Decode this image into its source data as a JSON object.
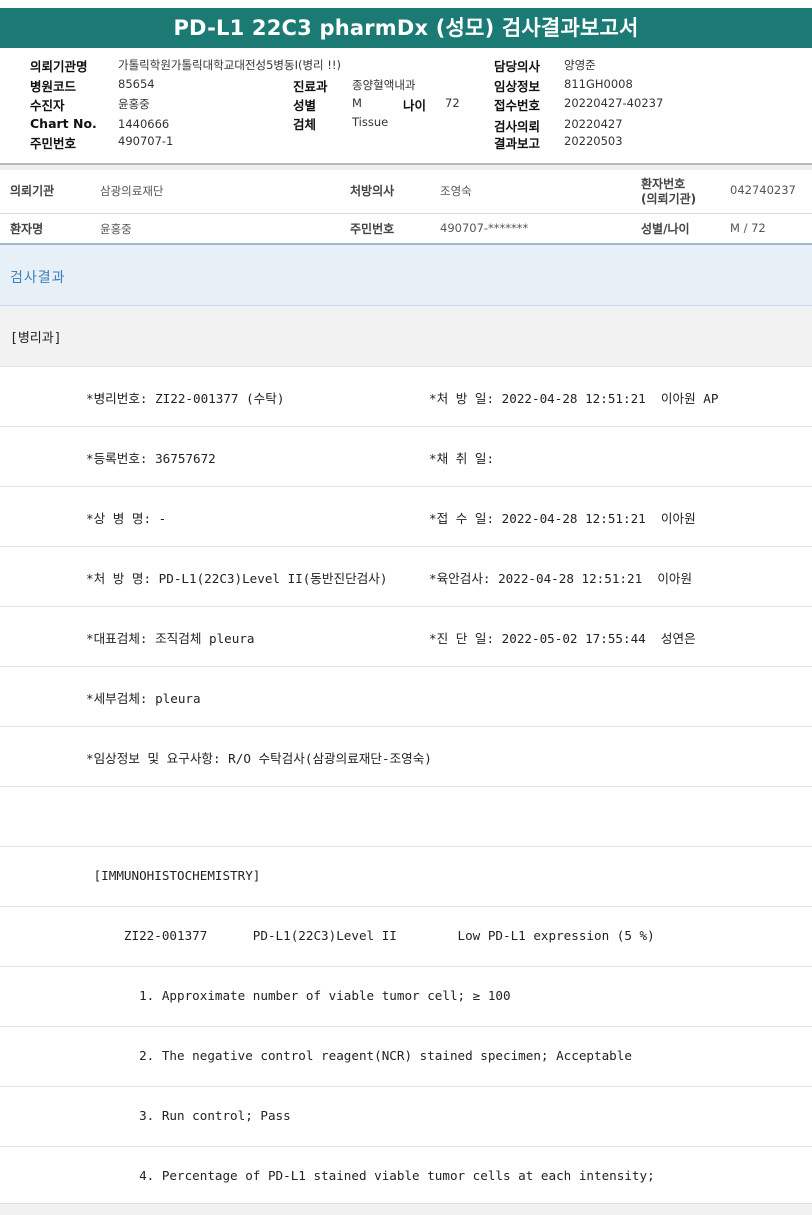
{
  "title": "PD-L1 22C3 pharmDx (성모) 검사결과보고서",
  "header": {
    "col1": [
      {
        "label": "의뢰기관명",
        "value": "가톨릭학원가톨릭대학교대전성5병동I(병리 !!)"
      },
      {
        "label": "병원코드",
        "value": "85654"
      },
      {
        "label": "수진자",
        "value": "윤홍중"
      },
      {
        "label": "Chart No.",
        "value": "1440666"
      },
      {
        "label": "주민번호",
        "value": "490707-1"
      }
    ],
    "col2": [
      {
        "label": "진료과",
        "value": "종양혈액내과"
      },
      {
        "label": "성별",
        "value": "M"
      },
      {
        "label": "나이",
        "value": "72"
      },
      {
        "label": "검체",
        "value": "Tissue"
      }
    ],
    "col3": [
      {
        "label": "담당의사",
        "value": "양영준"
      },
      {
        "label": "임상정보",
        "value": "811GH0008"
      },
      {
        "label": "접수번호",
        "value": "20220427-40237"
      },
      {
        "label": "검사의뢰",
        "value": "20220427"
      },
      {
        "label": "결과보고",
        "value": "20220503"
      }
    ]
  },
  "patient": {
    "row1": {
      "agency_label": "의뢰기관",
      "agency_value": "삼광의료재단",
      "doctor_label": "처방의사",
      "doctor_value": "조영숙",
      "pid_label_1": "환자번호",
      "pid_label_2": "(의뢰기관)",
      "pid_value": "042740237"
    },
    "row2": {
      "name_label": "환자명",
      "name_value": "윤홍중",
      "rrn_label": "주민번호",
      "rrn_value": "490707-*******",
      "sexage_label": "성별/나이",
      "sexage_value": "M / 72"
    }
  },
  "result_header": "검사결과",
  "department": "[병리과]",
  "lines": [
    {
      "a": "*병리번호: ZI22-001377 (수탁)",
      "b": "*처 방 일: 2022-04-28 12:51:21  이아원 AP"
    },
    {
      "a": "*등록번호: 36757672",
      "b": "*채 취 일:"
    },
    {
      "a": "*상 병 명: -",
      "b": "*접 수 일: 2022-04-28 12:51:21  이아원"
    },
    {
      "a": "*처 방 명: PD-L1(22C3)Level II(동반진단검사)",
      "b": "*육안검사: 2022-04-28 12:51:21  이아원"
    },
    {
      "a": "*대표검체: 조직검체 pleura",
      "b": "*진 단 일: 2022-05-02 17:55:44  성연은"
    },
    {
      "a": "*세부검체: pleura",
      "b": ""
    },
    {
      "a": "*임상정보 및 요구사항: R/O 수탁검사(삼광의료재단-조영숙)",
      "b": ""
    },
    {
      "a": "",
      "b": ""
    },
    {
      "a": " [IMMUNOHISTOCHEMISTRY]",
      "b": ""
    },
    {
      "a": "     ZI22-001377      PD-L1(22C3)Level II        Low PD-L1 expression (5 %)",
      "b": ""
    },
    {
      "a": "       1. Approximate number of viable tumor cell; ≥ 100",
      "b": ""
    },
    {
      "a": "       2. The negative control reagent(NCR) stained specimen; Acceptable",
      "b": ""
    },
    {
      "a": "       3. Run control; Pass",
      "b": ""
    },
    {
      "a": "       4. Percentage of PD-L1 stained viable tumor cells at each intensity;",
      "b": ""
    }
  ]
}
